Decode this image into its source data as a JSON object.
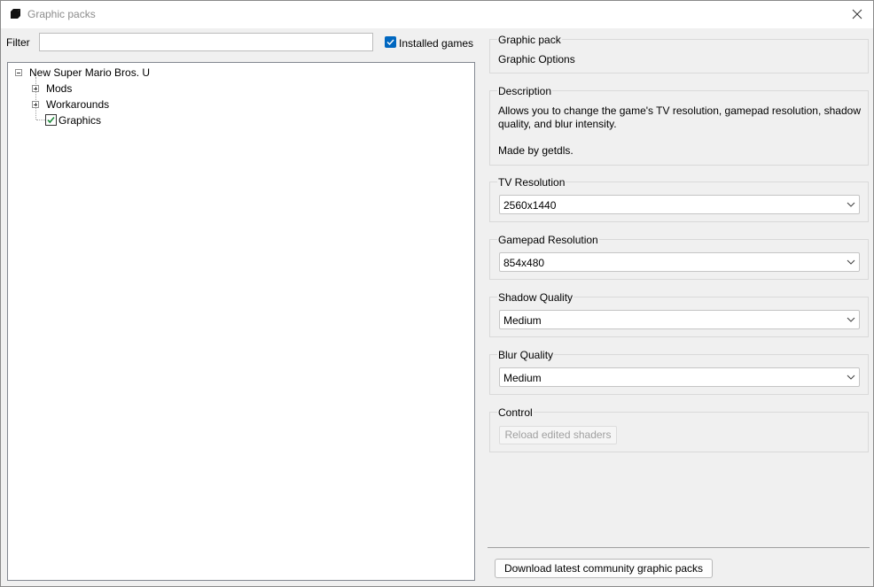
{
  "window": {
    "title": "Graphic packs"
  },
  "filter": {
    "label": "Filter",
    "value": "",
    "installed_games_label": "Installed games",
    "installed_games_checked": true
  },
  "tree": {
    "root": "New Super Mario Bros. U",
    "children": [
      {
        "label": "Mods",
        "type": "folder"
      },
      {
        "label": "Workarounds",
        "type": "folder"
      },
      {
        "label": "Graphics",
        "type": "pack",
        "checked": true
      }
    ]
  },
  "graphic_pack": {
    "label": "Graphic pack",
    "name": "Graphic Options"
  },
  "description": {
    "label": "Description",
    "line1": "Allows you to change the game's TV resolution, gamepad resolution, shadow",
    "line2": "quality, and blur intensity.",
    "author": "Made by getdls."
  },
  "presets": [
    {
      "label": "TV Resolution",
      "value": "2560x1440"
    },
    {
      "label": "Gamepad Resolution",
      "value": "854x480"
    },
    {
      "label": "Shadow Quality",
      "value": "Medium"
    },
    {
      "label": "Blur Quality",
      "value": "Medium"
    }
  ],
  "control": {
    "label": "Control",
    "reload_label": "Reload edited shaders"
  },
  "download_label": "Download latest community graphic packs",
  "colors": {
    "accent": "#0067c0",
    "check_green": "#1e8a3c"
  }
}
